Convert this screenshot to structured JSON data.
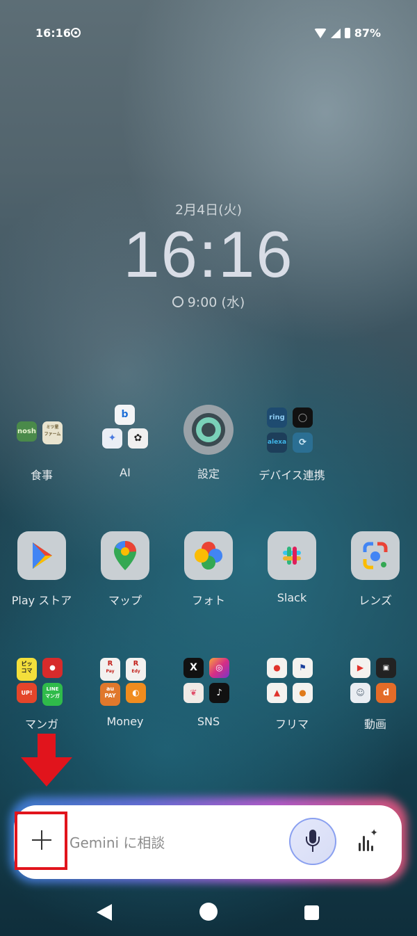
{
  "status_bar": {
    "time": "16:16",
    "battery": "87%"
  },
  "lock": {
    "date": "2月4日(火)",
    "time": "16:16",
    "alarm": "9:00 (水)"
  },
  "folders_row1": [
    {
      "label": "食事",
      "icons": [
        "nosh",
        "ミツ星ファーム"
      ]
    },
    {
      "label": "AI",
      "icons": [
        "bing",
        "gemini",
        "chatgpt"
      ]
    }
  ],
  "settings": {
    "label": "設定"
  },
  "device_folder": {
    "label": "デバイス連携",
    "icons": [
      "ring",
      "camera",
      "alexa",
      "sync"
    ]
  },
  "dock_apps": [
    {
      "label": "Play ストア",
      "icon": "play-store-icon"
    },
    {
      "label": "マップ",
      "icon": "maps-icon"
    },
    {
      "label": "フォト",
      "icon": "photos-icon"
    },
    {
      "label": "Slack",
      "icon": "slack-icon"
    },
    {
      "label": "レンズ",
      "icon": "lens-icon"
    }
  ],
  "folders_row3": [
    {
      "label": "マンガ",
      "icons": [
        "ピッコマ",
        "manga",
        "マンガUP!",
        "LINEマンガ"
      ]
    },
    {
      "label": "Money",
      "icons": [
        "R Pay",
        "R Edy",
        "au PAY",
        "coin"
      ]
    },
    {
      "label": "SNS",
      "icons": [
        "X",
        "Instagram",
        "Threads",
        "TikTok"
      ]
    },
    {
      "label": "フリマ",
      "icons": [
        "メルカリ",
        "flag",
        "Yahoo",
        "fruit"
      ]
    },
    {
      "label": "動画",
      "icons": [
        "YouTube",
        "niconico",
        "anime",
        "dアニメ"
      ]
    }
  ],
  "gemini_bar": {
    "placeholder": "Gemini に相談"
  },
  "colors": {
    "annotation_red": "#e1141c",
    "gemini_glow": "#6c6fe0"
  }
}
